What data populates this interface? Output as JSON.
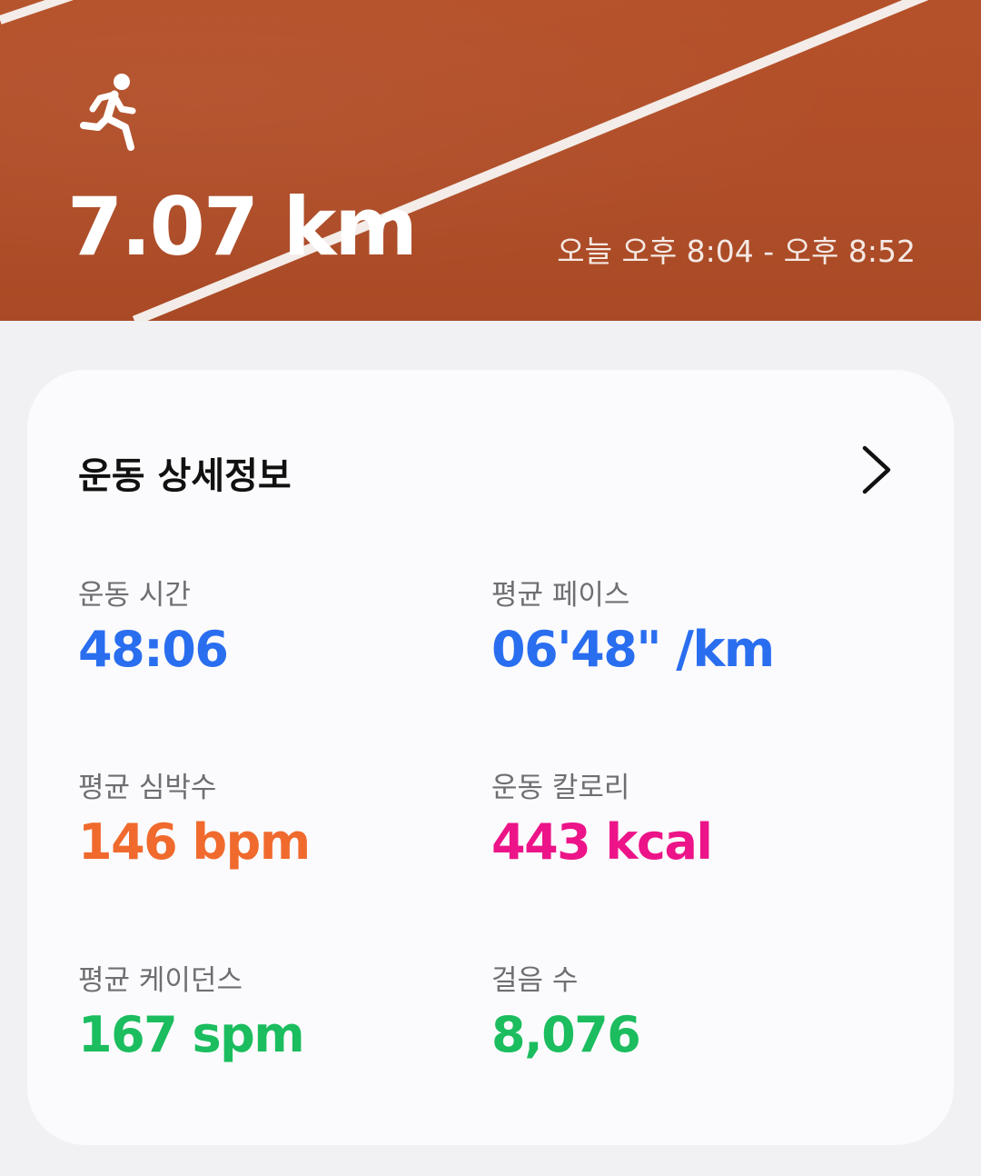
{
  "header": {
    "activity_icon": "running-person-icon",
    "distance": "7.07 km",
    "time_range": "오늘 오후 8:04 - 오후 8:52"
  },
  "details": {
    "title": "운동 상세정보",
    "more_icon": "chevron-right-icon",
    "stats": [
      {
        "label": "운동 시간",
        "value": "48:06",
        "color": "#2a6ef0"
      },
      {
        "label": "평균 페이스",
        "value": "06'48\" /km",
        "color": "#2a6ef0"
      },
      {
        "label": "평균 심박수",
        "value": "146 bpm",
        "color": "#f06a2e"
      },
      {
        "label": "운동 칼로리",
        "value": "443 kcal",
        "color": "#ec1488"
      },
      {
        "label": "평균 케이던스",
        "value": "167 spm",
        "color": "#1bbd5e"
      },
      {
        "label": "걸음 수",
        "value": "8,076",
        "color": "#1bbd5e"
      }
    ]
  },
  "colors": {
    "track": "#b04e29",
    "background": "#f1f1f3",
    "card": "#fbfbfd"
  }
}
